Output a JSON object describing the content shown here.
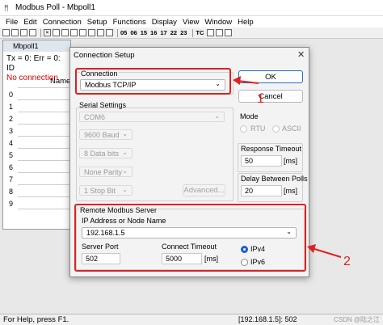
{
  "window": {
    "title": "Modbus Poll - Mbpoll1",
    "icon": "modbus-app-icon"
  },
  "menu": [
    "File",
    "Edit",
    "Connection",
    "Setup",
    "Functions",
    "Display",
    "View",
    "Window",
    "Help"
  ],
  "toolbar": {
    "function_codes": [
      "05",
      "06",
      "15",
      "16",
      "17",
      "22",
      "23"
    ],
    "tc": "TC"
  },
  "child": {
    "title": "Mbpoll1",
    "status": "Tx = 0: Err = 0: ID",
    "error": "No connection",
    "column_header": "Name",
    "rows": [
      "0",
      "1",
      "2",
      "3",
      "4",
      "5",
      "6",
      "7",
      "8",
      "9"
    ]
  },
  "dialog": {
    "title": "Connection Setup",
    "connection_label": "Connection",
    "connection_value": "Modbus TCP/IP",
    "ok": "OK",
    "cancel": "Cancel",
    "serial": {
      "label": "Serial Settings",
      "port": "COM6",
      "baud": "9600 Baud",
      "data_bits": "8 Data bits",
      "parity": "None Parity",
      "stop_bit": "1 Stop Bit",
      "advanced": "Advanced..."
    },
    "mode": {
      "label": "Mode",
      "rtu": "RTU",
      "ascii": "ASCII"
    },
    "response_timeout": {
      "label": "Response Timeout",
      "value": "50",
      "unit": "[ms]"
    },
    "delay_polls": {
      "label": "Delay Between Polls",
      "value": "20",
      "unit": "[ms]"
    },
    "remote": {
      "label": "Remote Modbus Server",
      "ip_label": "IP Address or Node Name",
      "ip_value": "192.168.1.5",
      "port_label": "Server Port",
      "port_value": "502",
      "ct_label": "Connect Timeout",
      "ct_value": "5000",
      "ct_unit": "[ms]",
      "ipv4": "IPv4",
      "ipv6": "IPv6"
    }
  },
  "annotations": {
    "one": "1",
    "two": "2"
  },
  "status_bar": {
    "help": "For Help, press F1.",
    "conn": "[192.168.1.5]: 502",
    "watermark": "CSDN @陆之江"
  },
  "colors": {
    "annotation": "#e02020",
    "accent": "#1a5fd0",
    "error": "#e00000"
  }
}
